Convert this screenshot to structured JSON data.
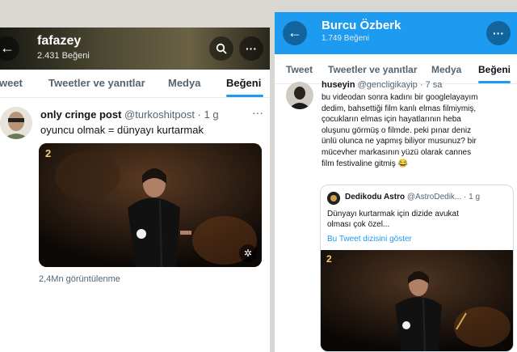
{
  "left": {
    "header": {
      "name": "fafazey",
      "subtitle": "2.431 Beğeni",
      "back_icon": "arrow-left-icon",
      "search_icon": "search-icon",
      "more_icon": "more-icon"
    },
    "tabs": [
      "Tweet",
      "Tweetler ve yanıtlar",
      "Medya",
      "Beğeni"
    ],
    "tweet": {
      "name": "only cringe post",
      "handle": "@turkoshitpost · 1 g",
      "more": "···",
      "text": "oyuncu olmak = dünyayı kurtarmak",
      "views": "2,4Mn görüntülenme",
      "media_badge": "2"
    }
  },
  "right": {
    "header": {
      "name": "Burcu Özberk",
      "subtitle": "1.749 Beğeni",
      "back_icon": "arrow-left-icon",
      "more_icon": "more-icon"
    },
    "tabs": [
      "Tweet",
      "Tweetler ve yanıtlar",
      "Medya",
      "Beğeni"
    ],
    "tweet": {
      "name": "huseyin",
      "handle": "@gencligikayip · 7 sa",
      "text_lines": [
        "bu videodan sonra kadını bir googlelayayım",
        "dedim, bahsettiği film kanlı elmas filmiymiş,",
        "çocukların elmas için hayatlarının heba",
        "oluşunu görmüş o filmde. peki pınar deniz",
        "ünlü olunca ne yapmış biliyor musunuz? bir",
        "mücevher markasının yüzü olarak cannes",
        "film festivaline gitmiş 😂"
      ],
      "quote": {
        "name": "Dedikodu Astro",
        "handle": "@AstroDedik... · 1 g",
        "text_lines": [
          "Dünyayı kurtarmak için dizide avukat",
          "olması çok özel..."
        ],
        "thread_link": "Bu Tweet dizisini göster",
        "media_badge": "2"
      }
    }
  }
}
